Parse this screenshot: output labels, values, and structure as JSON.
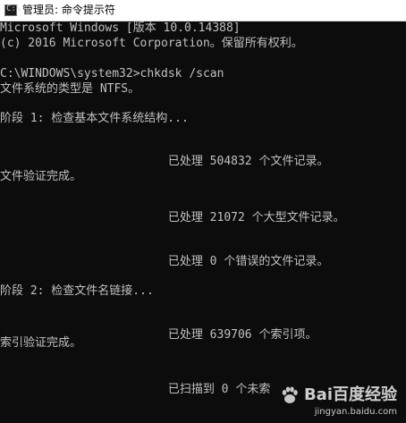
{
  "window": {
    "title": "管理员: 命令提示符",
    "icon": "cmd-icon"
  },
  "console": {
    "lines": [
      "Microsoft Windows [版本 10.0.14388]",
      "(c) 2016 Microsoft Corporation。保留所有权利。",
      "",
      "C:\\WINDOWS\\system32>chkdsk /scan",
      "文件系统的类型是 NTFS。",
      "",
      "阶段 1: 检查基本文件系统结构...",
      "",
      "                        已处理 504832 个文件记录。",
      "文件验证完成。",
      "",
      "                        已处理 21072 个大型文件记录。",
      "",
      "                        已处理 0 个错误的文件记录。",
      "",
      "阶段 2: 检查文件名链接...",
      "",
      "                        已处理 639706 个索引项。",
      "索引验证完成。",
      "",
      "                        已扫描到 0 个未索"
    ]
  },
  "watermark": {
    "brand": "Bai百度经验",
    "url": "jingyan.baidu.com",
    "icon": "baidu-paw-icon"
  }
}
